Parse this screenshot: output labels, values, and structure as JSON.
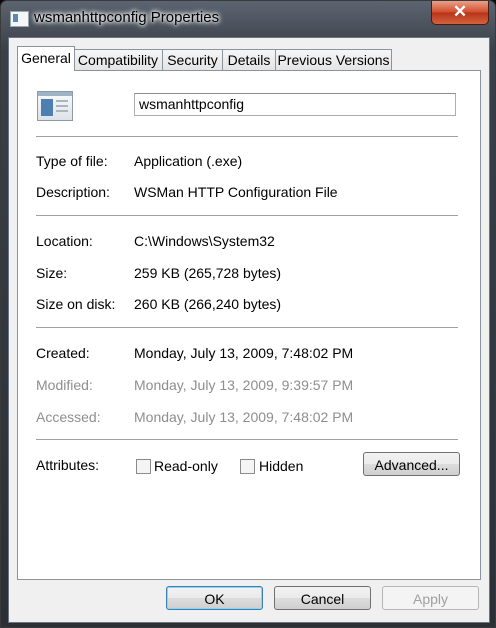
{
  "window": {
    "title": "wsmanhttpconfig Properties",
    "close_label": "✕"
  },
  "tabs": [
    {
      "label": "General",
      "active": true
    },
    {
      "label": "Compatibility",
      "active": false
    },
    {
      "label": "Security",
      "active": false
    },
    {
      "label": "Details",
      "active": false
    },
    {
      "label": "Previous Versions",
      "active": false
    }
  ],
  "general": {
    "file_name": "wsmanhttpconfig",
    "type_label": "Type of file:",
    "type_value": "Application (.exe)",
    "description_label": "Description:",
    "description_value": "WSMan HTTP Configuration File",
    "location_label": "Location:",
    "location_value": "C:\\Windows\\System32",
    "size_label": "Size:",
    "size_value": "259 KB (265,728 bytes)",
    "size_on_disk_label": "Size on disk:",
    "size_on_disk_value": "260 KB (266,240 bytes)",
    "created_label": "Created:",
    "created_value": "Monday, July 13, 2009, 7:48:02 PM",
    "modified_label": "Modified:",
    "modified_value": "Monday, July 13, 2009, 9:39:57 PM",
    "accessed_label": "Accessed:",
    "accessed_value": "Monday, July 13, 2009, 7:48:02 PM",
    "attributes_label": "Attributes:",
    "readonly_label": "Read-only",
    "hidden_label": "Hidden",
    "advanced_label": "Advanced..."
  },
  "footer": {
    "ok_label": "OK",
    "cancel_label": "Cancel",
    "apply_label": "Apply"
  },
  "icons": [
    "window-icon",
    "application-file-icon",
    "close-icon"
  ]
}
